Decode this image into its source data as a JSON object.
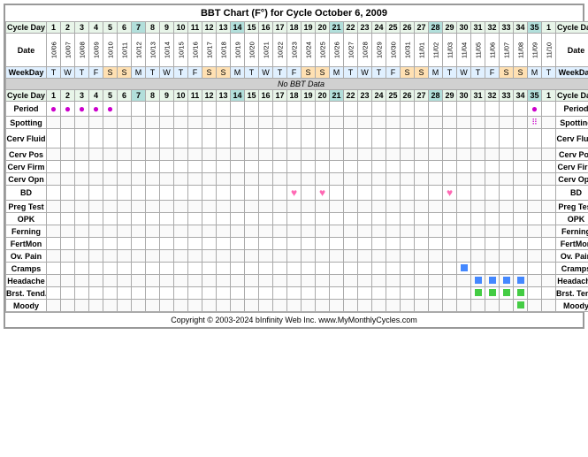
{
  "title": "BBT Chart (F°) for Cycle October 6, 2009",
  "footer": "Copyright © 2003-2024 bInfinity Web Inc.    www.MyMonthlyCycles.com",
  "header": {
    "cycle_day_label": "Cycle Day",
    "date_label": "Date",
    "weekday_label": "WeekDay"
  },
  "cycle_days": [
    "1",
    "2",
    "3",
    "4",
    "5",
    "6",
    "7",
    "8",
    "9",
    "10",
    "11",
    "12",
    "13",
    "14",
    "15",
    "16",
    "17",
    "18",
    "19",
    "20",
    "21",
    "22",
    "23",
    "24",
    "25",
    "26",
    "27",
    "28",
    "29",
    "30",
    "31",
    "32",
    "33",
    "34",
    "35",
    "1"
  ],
  "dates": [
    "10/06",
    "10/07",
    "10/08",
    "10/09",
    "10/10",
    "10/11",
    "10/12",
    "10/13",
    "10/14",
    "10/15",
    "10/16",
    "10/17",
    "10/18",
    "10/19",
    "10/20",
    "10/21",
    "10/22",
    "10/23",
    "10/24",
    "10/25",
    "10/26",
    "10/27",
    "10/28",
    "10/29",
    "10/30",
    "10/31",
    "11/01",
    "11/02",
    "11/03",
    "11/04",
    "11/05",
    "11/06",
    "11/07",
    "11/08",
    "11/09",
    "11/10"
  ],
  "weekdays": [
    "T",
    "W",
    "T",
    "F",
    "S",
    "S",
    "M",
    "T",
    "W",
    "T",
    "F",
    "S",
    "S",
    "M",
    "T",
    "W",
    "T",
    "F",
    "S",
    "S",
    "M",
    "T",
    "W",
    "T",
    "F",
    "S",
    "S",
    "M",
    "T",
    "W",
    "T",
    "F",
    "S",
    "S",
    "M",
    "T"
  ],
  "no_bbt": "No BBT Data",
  "rows": {
    "period": "Period",
    "spotting": "Spotting",
    "cerv_fluid": "Cerv Fluid",
    "cerv_pos": "Cerv Pos",
    "cerv_firm": "Cerv Firm",
    "cerv_opn": "Cerv Opn",
    "bd": "BD",
    "preg_test": "Preg Test",
    "opk": "OPK",
    "ferning": "Ferning",
    "fertmon": "FertMon",
    "ov_pain": "Ov. Pain",
    "cramps": "Cramps",
    "headache": "Headache",
    "brst_tend": "Brst. Tend.",
    "moody": "Moody"
  },
  "period_days": [
    1,
    2,
    3,
    4,
    5,
    35
  ],
  "period_outline_days": [
    35
  ],
  "bd_days": [
    18,
    20,
    29
  ],
  "spotting_days": [
    35
  ],
  "cramps_days": [
    30
  ],
  "headache_days": [
    31,
    32,
    33,
    34
  ],
  "brsttend_days": [
    31,
    32,
    33,
    34
  ],
  "moody_days": [
    34
  ]
}
